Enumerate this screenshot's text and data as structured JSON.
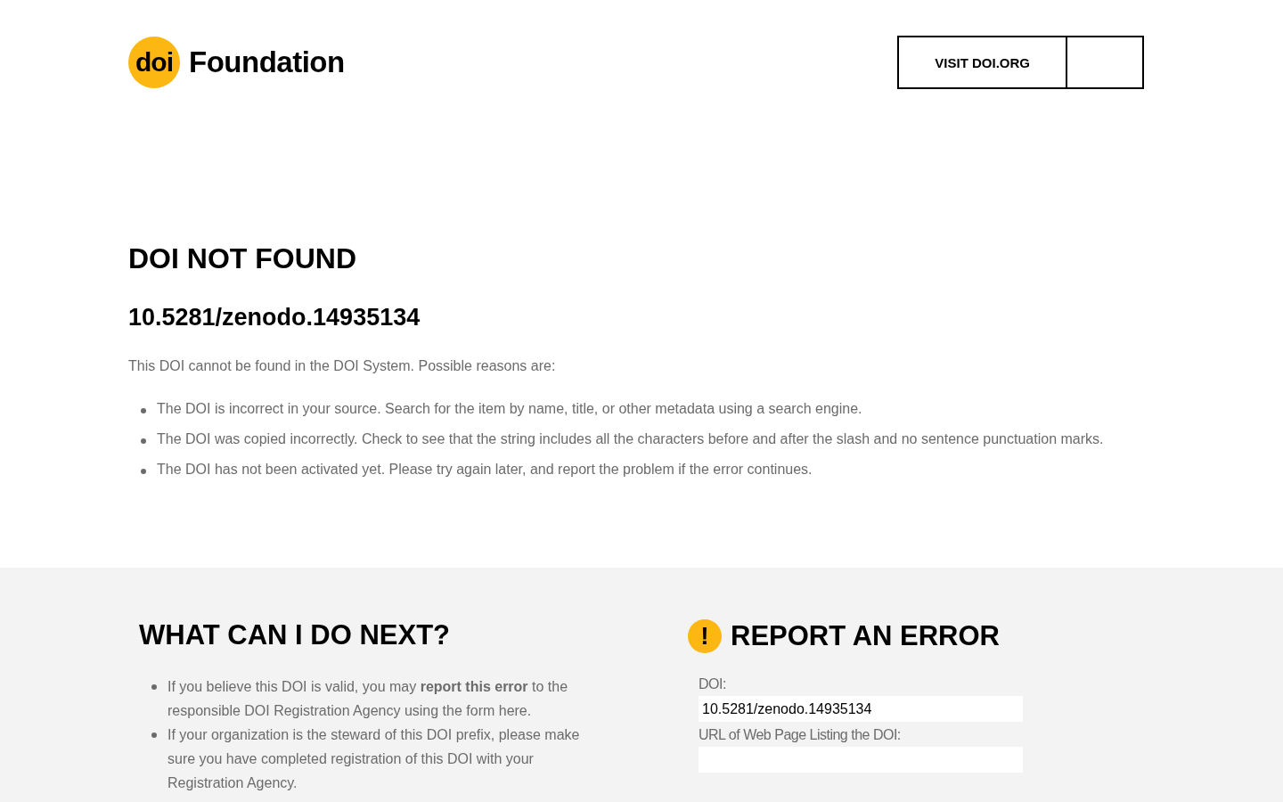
{
  "header": {
    "logo": {
      "badge": "doi",
      "wordmark": "Foundation"
    },
    "buttons": [
      {
        "label": "VISIT DOI.ORG"
      }
    ]
  },
  "main": {
    "title": "DOI NOT FOUND",
    "doi": "10.5281/zenodo.14935134",
    "intro": "This DOI cannot be found in the DOI System. Possible reasons are:",
    "reasons": [
      "The DOI is incorrect in your source. Search for the item by name, title, or other metadata using a search engine.",
      "The DOI was copied incorrectly. Check to see that the string includes all the characters before and after the slash and no sentence punctuation marks.",
      "The DOI has not been activated yet. Please try again later, and report the problem if the error continues."
    ]
  },
  "next": {
    "title": "WHAT CAN I DO NEXT?",
    "items": [
      "If you believe this DOI is valid, you may **report this error** to the responsible DOI Registration Agency using the form here.",
      "If your organization is the steward of this DOI prefix, please make sure you have completed registration of this DOI with your Registration Agency."
    ]
  },
  "report": {
    "icon": "!",
    "title": "REPORT AN ERROR",
    "fields": [
      {
        "label": "DOI:",
        "value": "10.5281/zenodo.14935134"
      },
      {
        "label": "URL of Web Page Listing the DOI:"
      }
    ]
  }
}
